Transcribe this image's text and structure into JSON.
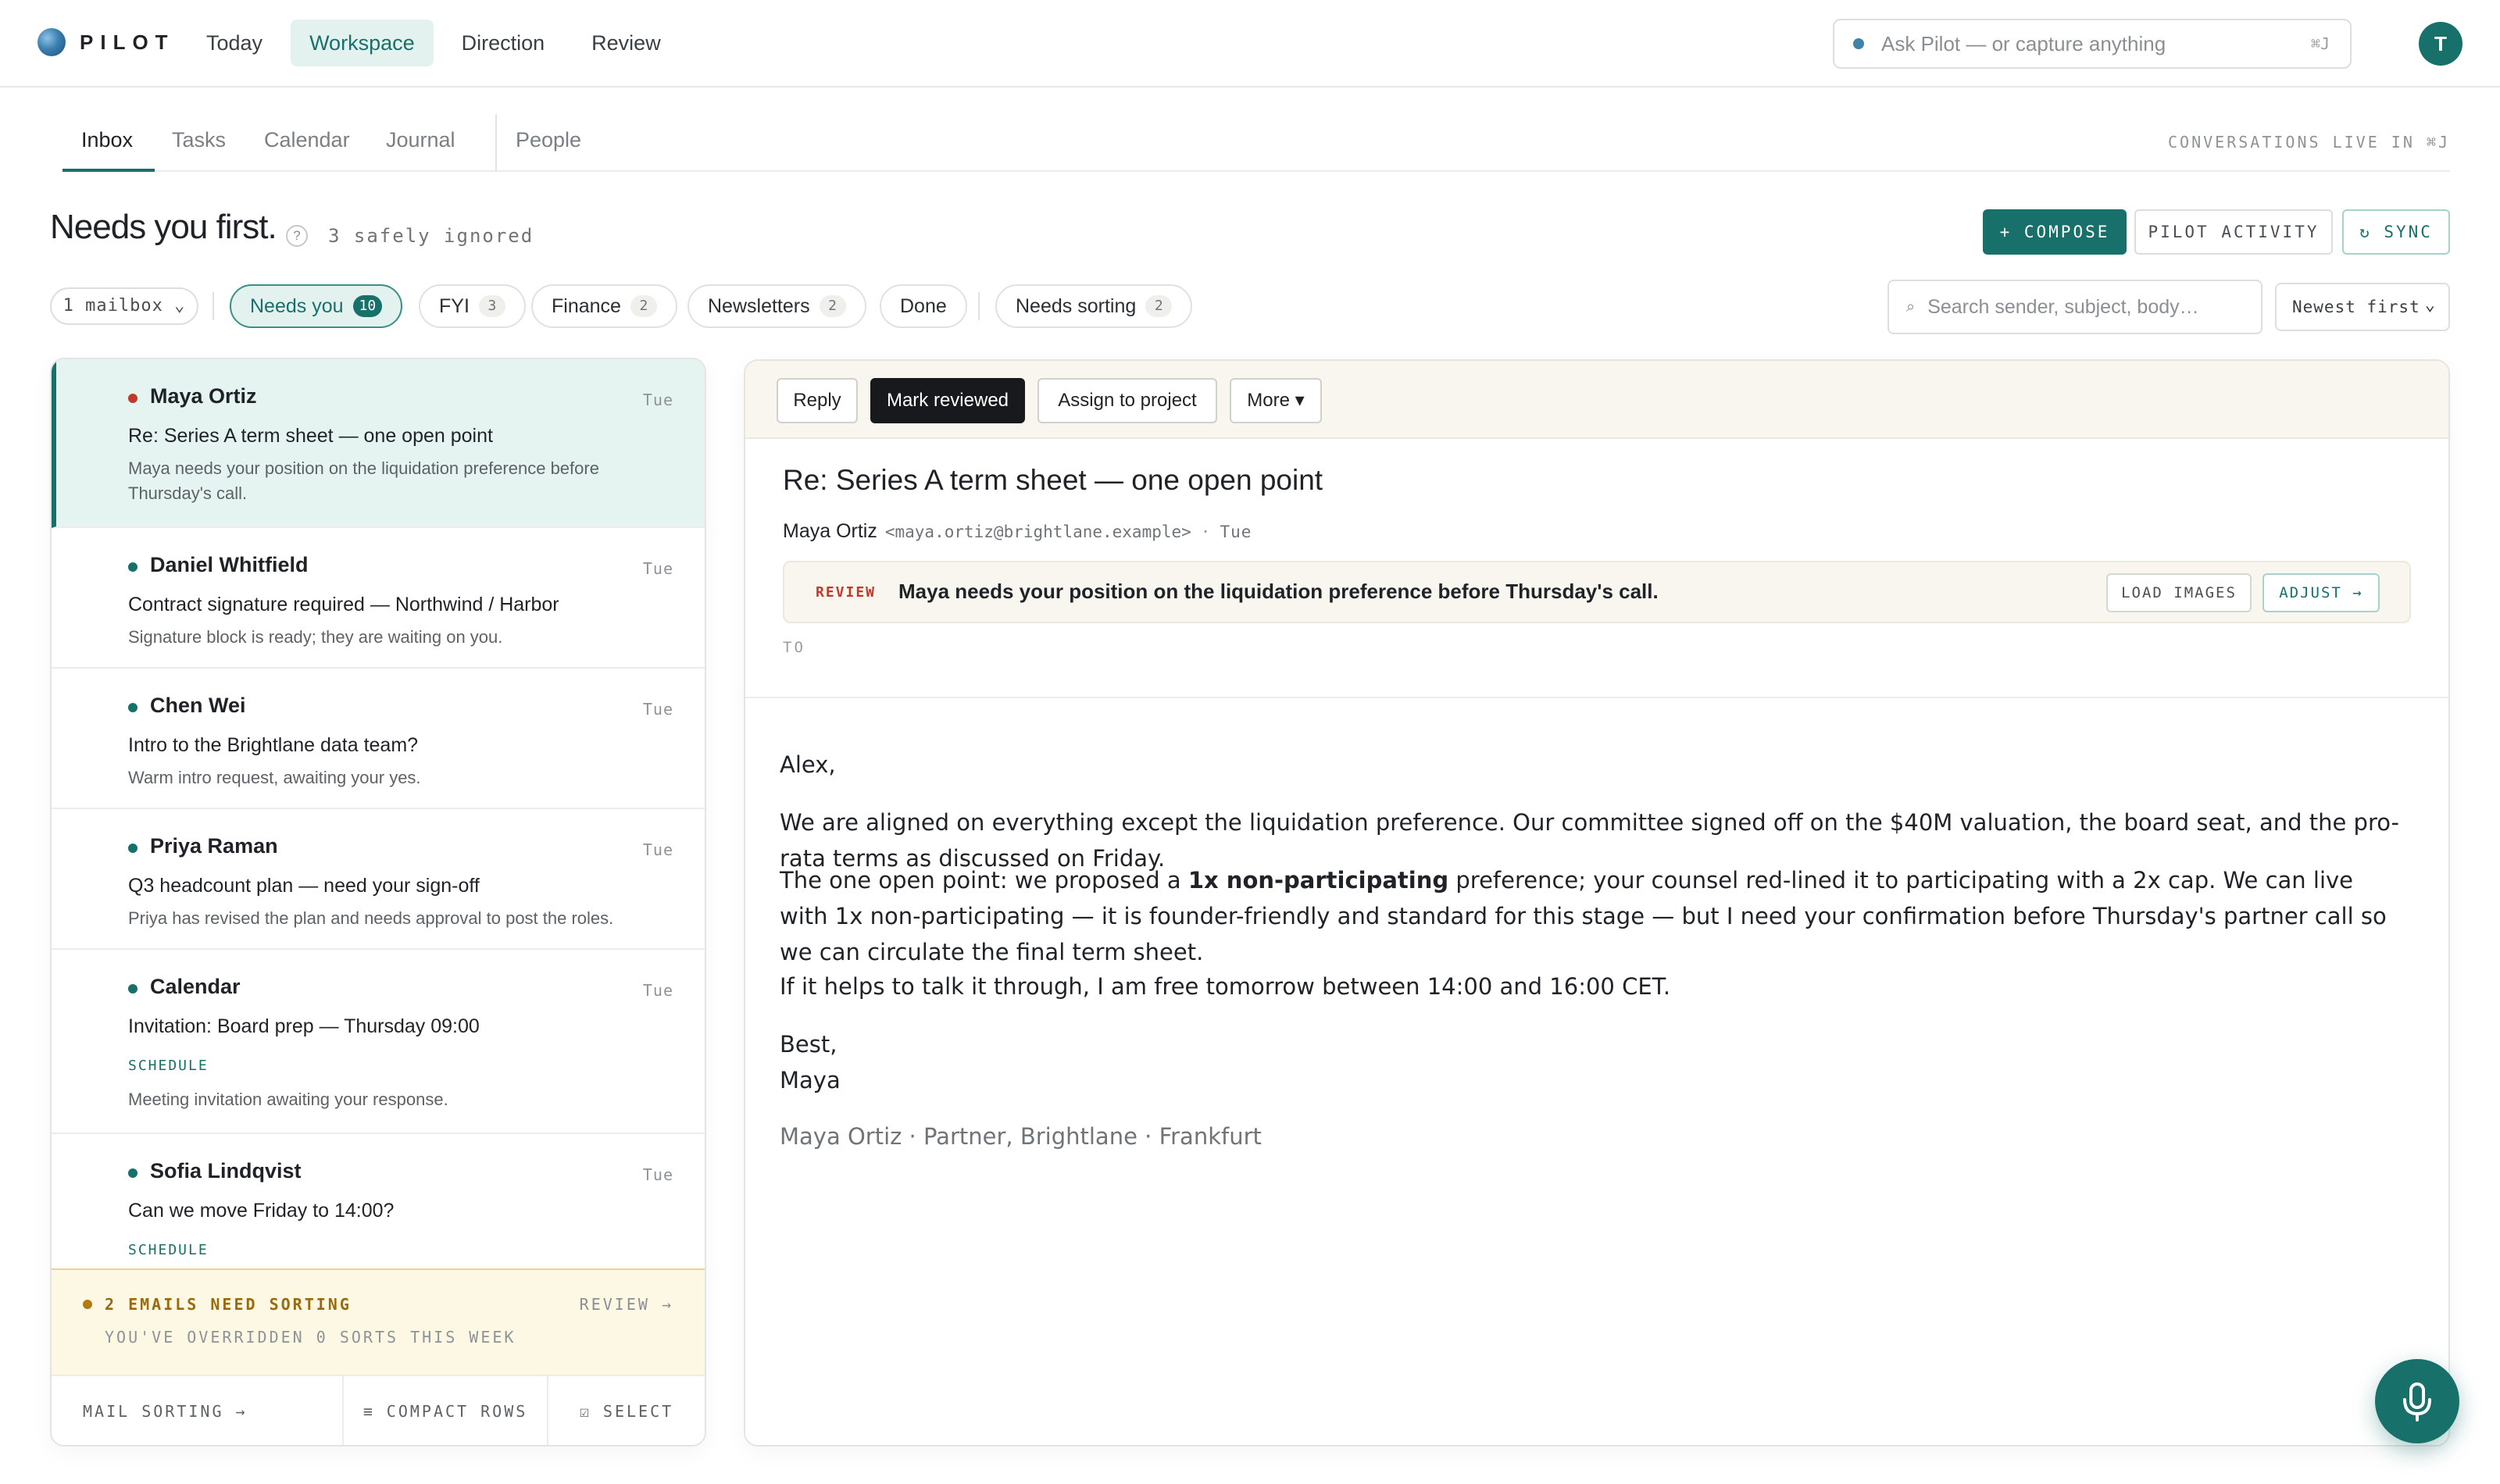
{
  "app": {
    "logo_text": "PILOT",
    "avatar_initial": "T"
  },
  "topnav": [
    {
      "label": "Today"
    },
    {
      "label": "Workspace",
      "active": true
    },
    {
      "label": "Direction"
    },
    {
      "label": "Review"
    }
  ],
  "ask": {
    "placeholder": "Ask Pilot — or capture anything",
    "shortcut": "⌘J"
  },
  "subtabs": {
    "items": [
      {
        "label": "Inbox",
        "active": true
      },
      {
        "label": "Tasks"
      },
      {
        "label": "Calendar"
      },
      {
        "label": "Journal"
      },
      {
        "label": "People"
      }
    ],
    "hint": "CONVERSATIONS LIVE IN ⌘J"
  },
  "heading": {
    "title": "Needs you first.",
    "help": "?",
    "ignored": "3 safely ignored"
  },
  "actions": {
    "compose": "+ COMPOSE",
    "activity": "PILOT ACTIVITY",
    "sync": "↻ SYNC"
  },
  "filters": {
    "mailbox": "1 mailbox ⌄",
    "chips": [
      {
        "label": "Needs you",
        "count": "10",
        "active": true
      },
      {
        "label": "FYI",
        "count": "3"
      },
      {
        "label": "Finance",
        "count": "2"
      },
      {
        "label": "Newsletters",
        "count": "2"
      },
      {
        "label": "Done",
        "count": ""
      },
      {
        "label": "Needs sorting",
        "count": "2"
      }
    ],
    "search_placeholder": "Search sender, subject, body…",
    "sort": "Newest first"
  },
  "list": [
    {
      "sender": "Maya Ortiz",
      "time": "Tue",
      "subject": "Re: Series A term sheet — one open point",
      "preview": "Maya needs your position on the liquidation preference before Thursday's call.",
      "tag": "",
      "urgent": true,
      "selected": true
    },
    {
      "sender": "Daniel Whitfield",
      "time": "Tue",
      "subject": "Contract signature required — Northwind / Harbor",
      "preview": "Signature block is ready; they are waiting on you.",
      "tag": ""
    },
    {
      "sender": "Chen Wei",
      "time": "Tue",
      "subject": "Intro to the Brightlane data team?",
      "preview": "Warm intro request, awaiting your yes.",
      "tag": ""
    },
    {
      "sender": "Priya Raman",
      "time": "Tue",
      "subject": "Q3 headcount plan — need your sign-off",
      "preview": "Priya has revised the plan and needs approval to post the roles.",
      "tag": ""
    },
    {
      "sender": "Calendar",
      "time": "Tue",
      "subject": "Invitation: Board prep — Thursday 09:00",
      "preview": "Meeting invitation awaiting your response.",
      "tag": "SCHEDULE"
    },
    {
      "sender": "Sofia Lindqvist",
      "time": "Tue",
      "subject": "Can we move Friday to 14:00?",
      "preview": "",
      "tag": "SCHEDULE"
    }
  ],
  "sorting_banner": {
    "title": "2 EMAILS NEED SORTING",
    "subtitle": "YOU'VE OVERRIDDEN 0 SORTS THIS WEEK",
    "review": "REVIEW →"
  },
  "list_footer": {
    "mail_sorting": "MAIL SORTING →",
    "compact": "≡ COMPACT ROWS",
    "select": "☑ SELECT"
  },
  "reader": {
    "buttons": {
      "reply": "Reply",
      "mark_reviewed": "Mark reviewed",
      "assign": "Assign to project",
      "more": "More ▾"
    },
    "subject": "Re: Series A term sheet — one open point",
    "from_name": "Maya Ortiz",
    "from_addr": "<maya.ortiz@brightlane.example>",
    "from_sep": "·",
    "when": "Tue",
    "review": {
      "tag": "REVIEW",
      "message": "Maya needs your position on the liquidation preference before Thursday's call.",
      "load_images": "LOAD IMAGES",
      "adjust": "ADJUST →"
    },
    "to_label": "TO",
    "body": {
      "greeting": "Alex,",
      "p1": "We are aligned on everything except the liquidation preference. Our committee signed off on the $40M valuation, the board seat, and the pro-rata terms as discussed on Friday.",
      "p2_before": "The one open point: we proposed a ",
      "p2_bold": "1x non-participating",
      "p2_after": " preference; your counsel red-lined it to participating with a 2x cap. We can live with 1x non-participating — it is founder-friendly and standard for this stage — but I need your confirmation before Thursday's partner call so we can circulate the final term sheet.",
      "p3": "If it helps to talk it through, I am free tomorrow between 14:00 and 16:00 CET.",
      "signoff": "Best,",
      "name": "Maya",
      "signature": "Maya Ortiz · Partner, Brightlane · Frankfurt"
    }
  },
  "colors": {
    "accent": "#17706a",
    "accent_light": "#e3f2ef",
    "urgent": "#c0392b",
    "warning_bg": "#fdf8e4"
  },
  "icons": [
    "logo-orb-icon",
    "search-icon",
    "help-icon",
    "microphone-icon",
    "status-dot-icon"
  ]
}
